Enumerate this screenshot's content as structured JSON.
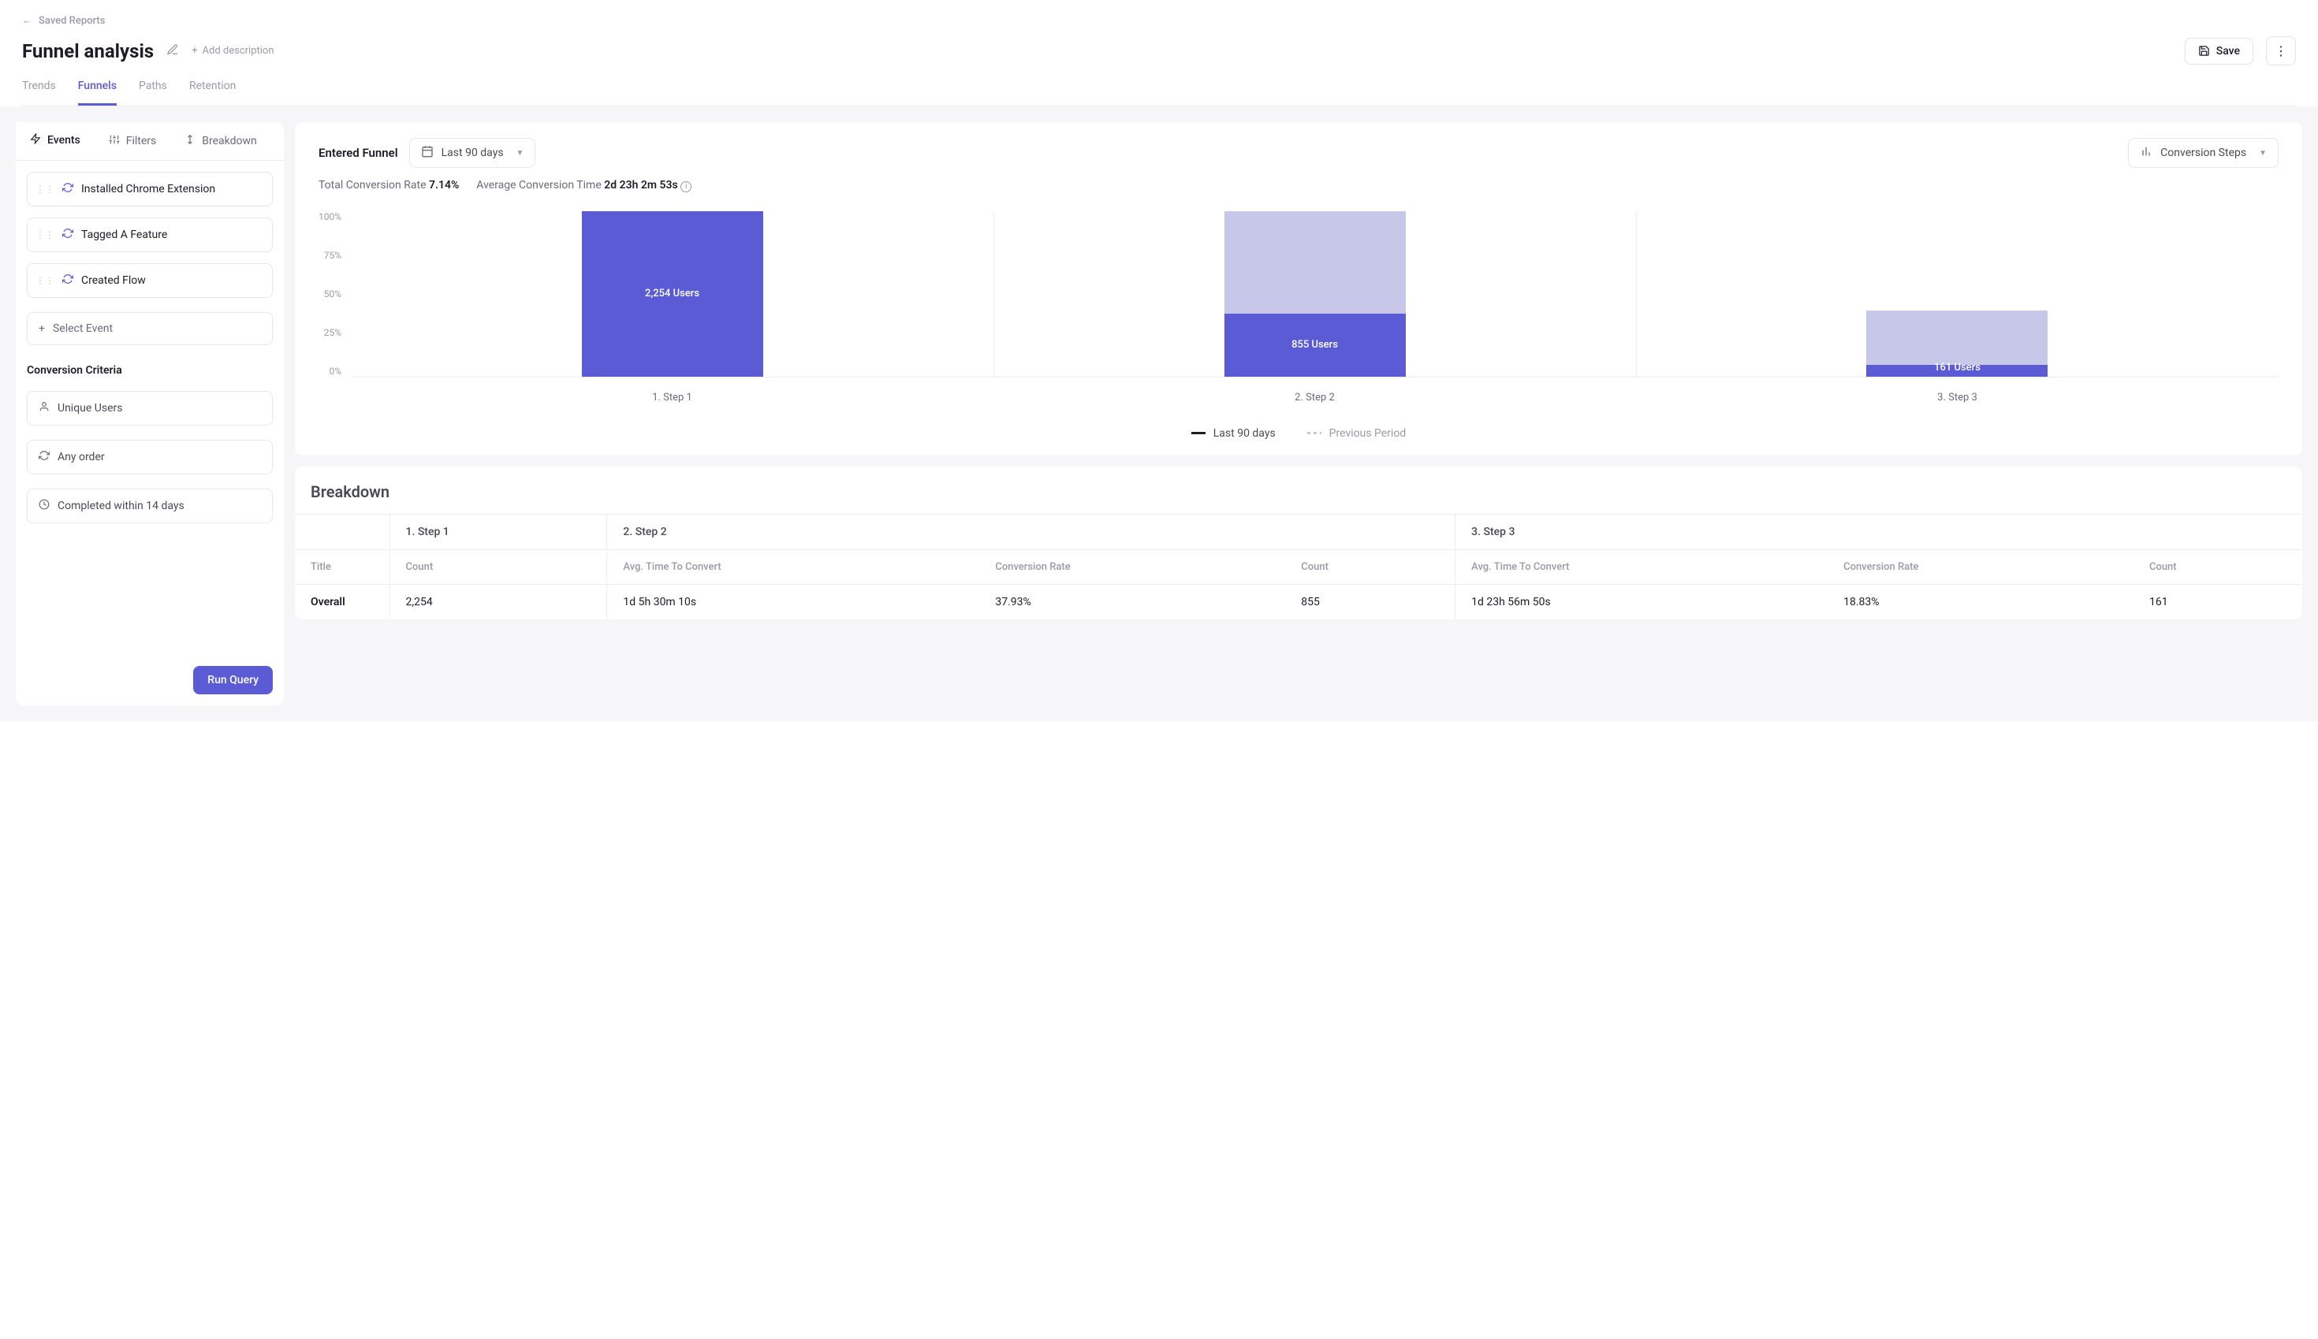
{
  "breadcrumb": "Saved Reports",
  "page_title": "Funnel analysis",
  "add_description": "Add description",
  "save_label": "Save",
  "tabs": [
    "Trends",
    "Funnels",
    "Paths",
    "Retention"
  ],
  "active_tab": 1,
  "sidebar": {
    "tabs": [
      "Events",
      "Filters",
      "Breakdown"
    ],
    "active": 0,
    "events": [
      "Installed Chrome Extension",
      "Tagged A Feature",
      "Created Flow"
    ],
    "select_event": "Select Event",
    "criteria_label": "Conversion Criteria",
    "criteria": [
      {
        "icon": "user",
        "label": "Unique Users"
      },
      {
        "icon": "order",
        "label": "Any order"
      },
      {
        "icon": "clock",
        "label": "Completed within 14 days"
      }
    ],
    "run_label": "Run Query"
  },
  "chart_panel": {
    "title": "Entered Funnel",
    "date_range": "Last 90 days",
    "view_mode": "Conversion Steps",
    "total_rate_label": "Total Conversion Rate",
    "total_rate_value": "7.14%",
    "avg_time_label": "Average Conversion Time",
    "avg_time_value": "2d 23h 2m 53s",
    "legend_current": "Last 90 days",
    "legend_previous": "Previous Period"
  },
  "chart_data": {
    "type": "bar",
    "ylabel": "",
    "ylim": [
      0,
      100
    ],
    "y_ticks": [
      "100%",
      "75%",
      "50%",
      "25%",
      "0%"
    ],
    "categories": [
      "1. Step 1",
      "2. Step 2",
      "3. Step 3"
    ],
    "series": [
      {
        "name": "Previous Period (background)",
        "values": [
          100,
          100,
          40
        ]
      },
      {
        "name": "Last 90 days",
        "values": [
          100,
          37.93,
          7.14
        ],
        "labels": [
          "2,254 Users",
          "855 Users",
          "161 Users"
        ]
      }
    ]
  },
  "breakdown": {
    "title": "Breakdown",
    "step_headers": [
      "1. Step 1",
      "2. Step 2",
      "3. Step 3"
    ],
    "columns": [
      "Title",
      "Count",
      "Avg. Time To Convert",
      "Conversion Rate",
      "Count",
      "Avg. Time To Convert",
      "Conversion Rate",
      "Count"
    ],
    "rows": [
      {
        "title": "Overall",
        "s1_count": "2,254",
        "s2_time": "1d 5h 30m 10s",
        "s2_rate": "37.93%",
        "s2_count": "855",
        "s3_time": "1d 23h 56m 50s",
        "s3_rate": "18.83%",
        "s3_count": "161"
      }
    ]
  }
}
